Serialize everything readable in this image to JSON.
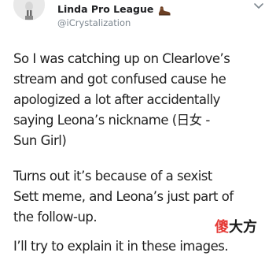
{
  "author": {
    "display_name": "Linda Pro League",
    "emoji_icon": "leg-emoji-icon",
    "handle": "@iCrystalization"
  },
  "actions": {
    "more_icon": "chevron-down-icon"
  },
  "tweet": {
    "paragraph_1": [
      "So I was catching up on Clearlove’s",
      "stream and got confused cause he",
      "apologized a lot after accidentally",
      "saying Leona’s nickname (日女 -",
      "Sun Girl)"
    ],
    "paragraph_2": [
      "Turns out it’s because of a sexist",
      "Sett meme, and Leona’s just part of",
      "the follow-up."
    ],
    "paragraph_3": [
      "I’ll try to explain it in these images."
    ]
  },
  "watermark": {
    "part_1": "傻",
    "part_2": "大方"
  },
  "colors": {
    "background": "#ffffff",
    "text": "#1f1f1f",
    "handle": "#7d8790",
    "watermark_accent": "#e53935"
  }
}
